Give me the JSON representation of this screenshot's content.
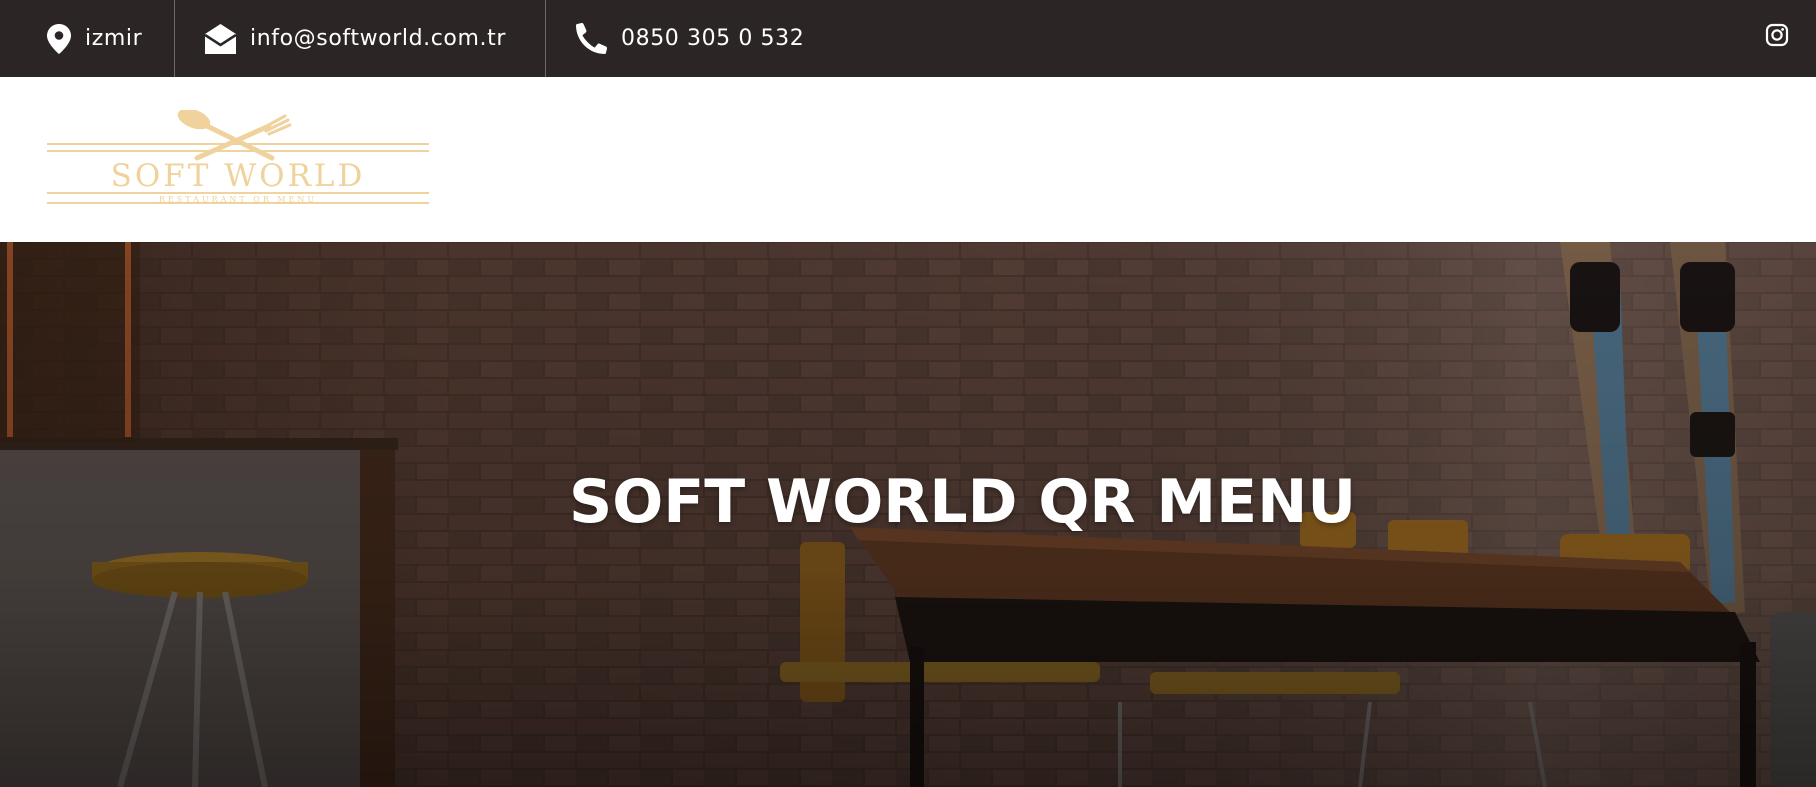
{
  "topbar": {
    "location": {
      "icon": "map-pin-icon",
      "text": "izmir"
    },
    "email": {
      "icon": "envelope-open-icon",
      "text": "info@softworld.com.tr"
    },
    "phone": {
      "icon": "phone-icon",
      "text": "0850 305 0 532"
    },
    "social": {
      "icon": "instagram-icon"
    },
    "background_color": "#2b2625"
  },
  "logo": {
    "wordmark": "SOFT WORLD",
    "tagline": "RESTAURANT QR MENU",
    "icon": "crossed-spoon-fork-icon",
    "color": "#efd29c"
  },
  "hero": {
    "title": "SOFT WORLD QR MENU",
    "background_description_icon": "restaurant-interior-image"
  }
}
